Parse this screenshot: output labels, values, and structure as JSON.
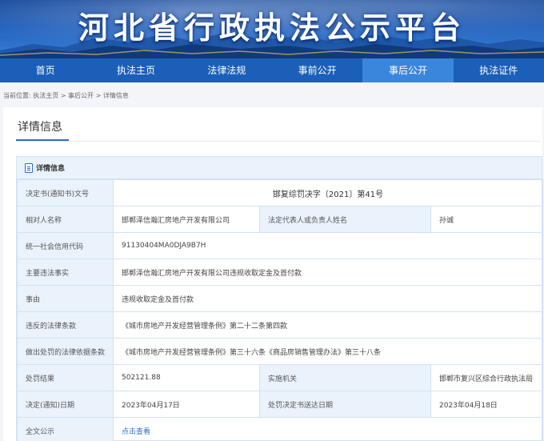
{
  "banner": {
    "title": "河北省行政执法公示平台"
  },
  "nav": {
    "items": [
      {
        "label": "首页"
      },
      {
        "label": "执法主页"
      },
      {
        "label": "法律法规"
      },
      {
        "label": "事前公开"
      },
      {
        "label": "事后公开"
      },
      {
        "label": "执法证件"
      }
    ],
    "active_index": 4
  },
  "breadcrumb": {
    "text": "当前位置: 执法主页 > 事后公开 > 详情信息"
  },
  "page": {
    "title": "详情信息"
  },
  "panel": {
    "title": "详情信息",
    "decision_no_label": "决定书(通知书)文号",
    "decision_no_value": "邯复综罚决字〔2021〕第41号",
    "party_label": "相对人名称",
    "party_value": "邯郸泽信瀚汇房地产开发有限公司",
    "legal_rep_label": "法定代表人或负责人姓名",
    "legal_rep_value": "孙诚",
    "credit_code_label": "统一社会信用代码",
    "credit_code_value": "91130404MA0DJA9B7H",
    "facts_label": "主要违法事实",
    "facts_value": "邯郸泽信瀚汇房地产开发有限公司违规收取定金及首付款",
    "cause_label": "事由",
    "cause_value": "违规收取定金及首付款",
    "violated_label": "违反的法律条款",
    "violated_value": "《城市房地产开发经营管理条例》第二十二条第四款",
    "basis_label": "做出处罚的法律依据条款",
    "basis_value": "《城市房地产开发经营管理条例》第三十六条《商品房销售管理办法》第三十八条",
    "result_label": "处罚结果",
    "result_value": "502121.88",
    "agency_label": "实施机关",
    "agency_value": "邯郸市复兴区综合行政执法局",
    "decision_date_label": "决定(通知)日期",
    "decision_date_value": "2023年04月17日",
    "delivery_date_label": "处罚决定书送达日期",
    "delivery_date_value": "2023年04月18日",
    "full_text_label": "全文公示",
    "full_text_link": "点击查看"
  }
}
